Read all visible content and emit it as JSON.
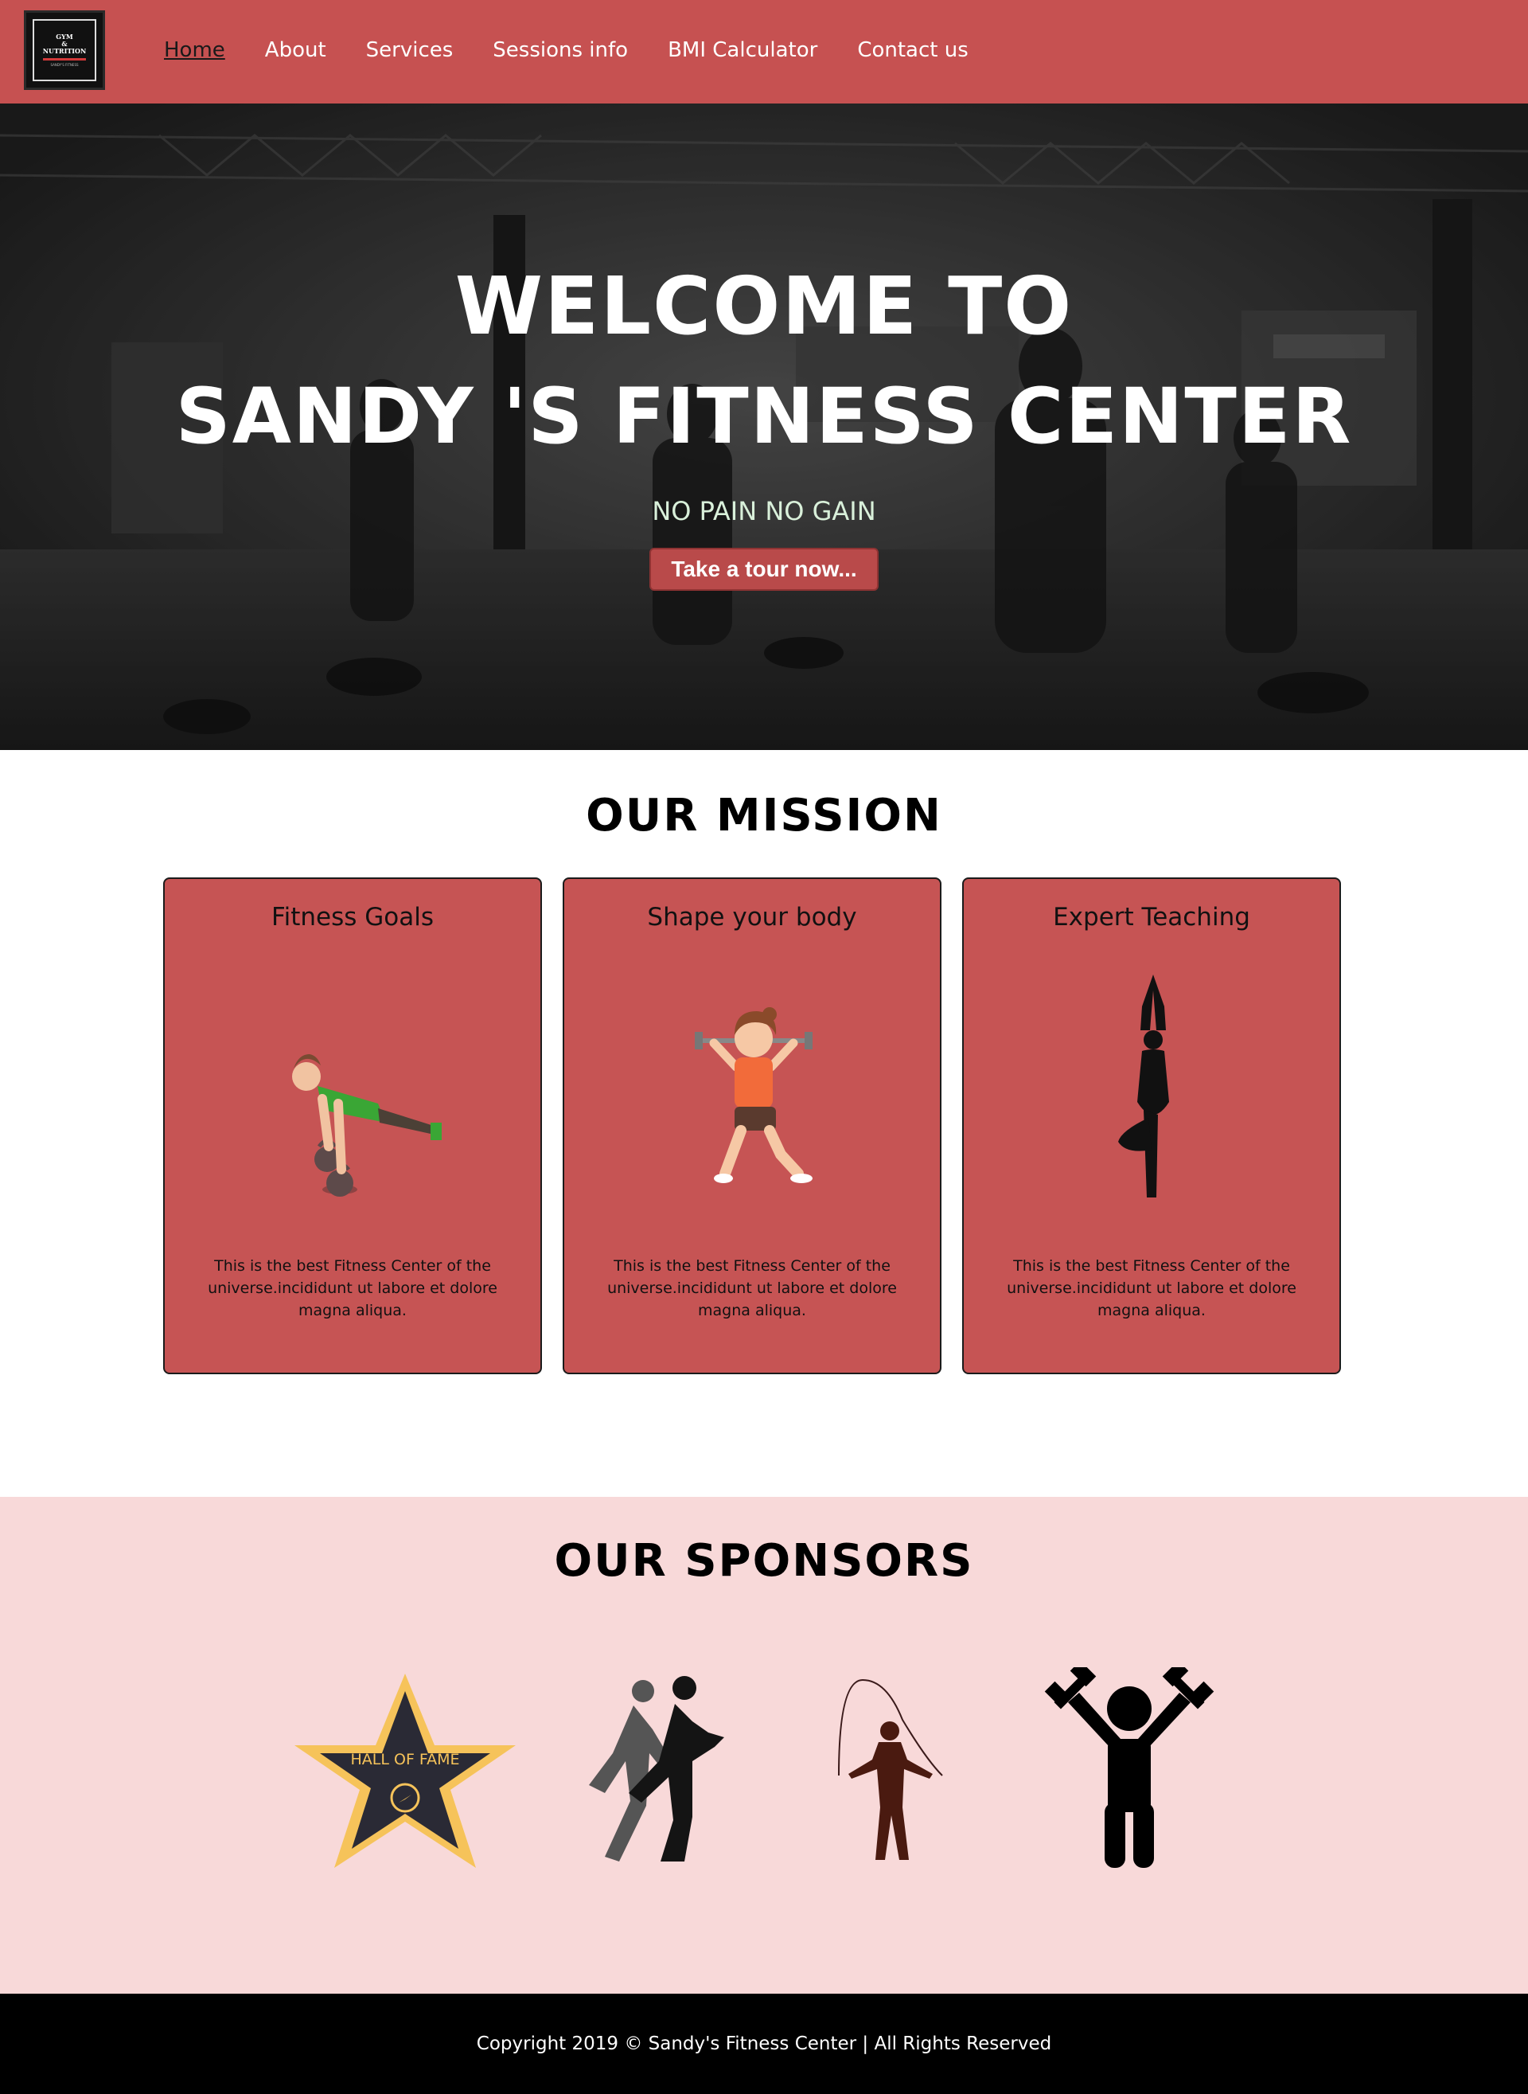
{
  "brand": {
    "logo_line1": "GYM",
    "logo_line2": "&",
    "logo_line3": "NUTRITION",
    "logo_tagline": "SANDY'S FITNESS"
  },
  "nav": {
    "items": [
      {
        "label": "Home",
        "active": true
      },
      {
        "label": "About"
      },
      {
        "label": "Services"
      },
      {
        "label": "Sessions info"
      },
      {
        "label": "BMI Calculator"
      },
      {
        "label": "Contact us"
      }
    ]
  },
  "hero": {
    "title_line1": "WELCOME TO",
    "title_line2": "SANDY 'S FITNESS CENTER",
    "tagline": "NO PAIN NO GAIN",
    "cta_label": "Take a tour now..."
  },
  "mission": {
    "title": "OUR MISSION",
    "cards": [
      {
        "title": "Fitness Goals",
        "text": "This is the best Fitness Center of the universe.incididunt ut labore et dolore magna aliqua.",
        "icon": "pushup-kettlebell-icon"
      },
      {
        "title": "Shape your body",
        "text": "This is the best Fitness Center of the universe.incididunt ut labore et dolore magna aliqua.",
        "icon": "dumbbell-lunge-icon"
      },
      {
        "title": "Expert Teaching",
        "text": "This is the best Fitness Center of the universe.incididunt ut labore et dolore magna aliqua.",
        "icon": "yoga-tree-pose-icon"
      }
    ]
  },
  "sponsors": {
    "title": "OUR SPONSORS",
    "items": [
      {
        "name": "hall-of-fame-star-icon",
        "text": "HALL OF FAME"
      },
      {
        "name": "runners-icon"
      },
      {
        "name": "jump-rope-icon"
      },
      {
        "name": "dumbbell-lifter-icon"
      }
    ]
  },
  "footer": {
    "copyright": "Copyright 2019 © Sandy's Fitness Center | All Rights Reserved"
  },
  "colors": {
    "brand_red": "#c65151",
    "sponsor_bg": "#f8d9d9",
    "footer_bg": "#000000",
    "tagline": "#d9f0da"
  }
}
